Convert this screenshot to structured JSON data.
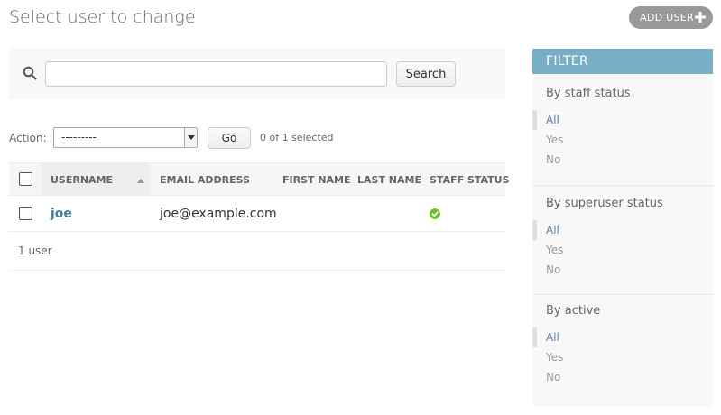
{
  "header": {
    "title": "Select user to change",
    "add_user_label": "ADD USER"
  },
  "search": {
    "button_label": "Search",
    "value": ""
  },
  "actions": {
    "label": "Action:",
    "selected_option": "---------",
    "go_label": "Go",
    "selected_count": "0 of 1 selected"
  },
  "table": {
    "columns": [
      "USERNAME",
      "EMAIL ADDRESS",
      "FIRST NAME",
      "LAST NAME",
      "STAFF STATUS"
    ],
    "rows": [
      {
        "username": "joe",
        "email": "joe@example.com",
        "first_name": "",
        "last_name": "",
        "staff_status": true
      }
    ],
    "result_count": "1 user"
  },
  "filter": {
    "title": "FILTER",
    "groups": [
      {
        "title": "By staff status",
        "options": [
          "All",
          "Yes",
          "No"
        ],
        "selected": "All"
      },
      {
        "title": "By superuser status",
        "options": [
          "All",
          "Yes",
          "No"
        ],
        "selected": "All"
      },
      {
        "title": "By active",
        "options": [
          "All",
          "Yes",
          "No"
        ],
        "selected": "All"
      }
    ]
  },
  "colors": {
    "filter_header": "#79aec8",
    "link": "#447e9b",
    "selected_filter": "#5b80b2",
    "status_ok": "#70bf2b",
    "add_button": "#999999"
  }
}
